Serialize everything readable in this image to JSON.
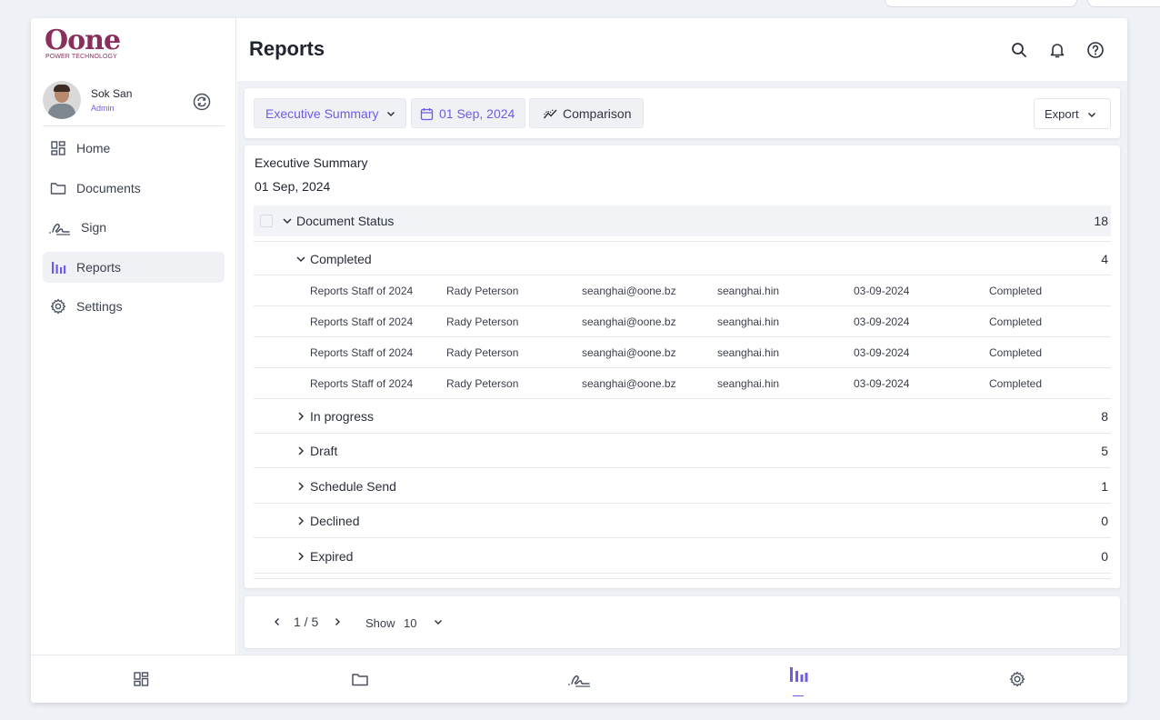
{
  "app": {
    "logo_text": "Oone",
    "logo_subtitle": "POWER TECHNOLOGY",
    "page_title": "Reports"
  },
  "user": {
    "name": "Sok San",
    "role": "Admin"
  },
  "sidebar": {
    "items": [
      {
        "label": "Home",
        "icon": "grid-icon",
        "active": false
      },
      {
        "label": "Documents",
        "icon": "folder-icon",
        "active": false
      },
      {
        "label": "Sign",
        "icon": "signature-icon",
        "active": false
      },
      {
        "label": "Reports",
        "icon": "bar-chart-icon",
        "active": true
      },
      {
        "label": "Settings",
        "icon": "gear-icon",
        "active": false
      }
    ]
  },
  "toolbar": {
    "report_type": "Executive Summary",
    "date": "01 Sep, 2024",
    "comparison_label": "Comparison",
    "export_label": "Export"
  },
  "report": {
    "title": "Executive Summary",
    "date": "01 Sep, 2024",
    "group": {
      "label": "Document Status",
      "count": "18"
    },
    "completed": {
      "label": "Completed",
      "count": "4",
      "rows": [
        {
          "document": "Reports Staff of 2024",
          "name": "Rady Peterson",
          "email": "seanghai@oone.bz",
          "username": "seanghai.hin",
          "date": "03-09-2024",
          "status": "Completed"
        },
        {
          "document": "Reports Staff of 2024",
          "name": "Rady Peterson",
          "email": "seanghai@oone.bz",
          "username": "seanghai.hin",
          "date": "03-09-2024",
          "status": "Completed"
        },
        {
          "document": "Reports Staff of 2024",
          "name": "Rady Peterson",
          "email": "seanghai@oone.bz",
          "username": "seanghai.hin",
          "date": "03-09-2024",
          "status": "Completed"
        },
        {
          "document": "Reports Staff of 2024",
          "name": "Rady Peterson",
          "email": "seanghai@oone.bz",
          "username": "seanghai.hin",
          "date": "03-09-2024",
          "status": "Completed"
        }
      ]
    },
    "statuses": [
      {
        "label": "In progress",
        "count": "8"
      },
      {
        "label": "Draft",
        "count": "5"
      },
      {
        "label": "Schedule Send",
        "count": "1"
      },
      {
        "label": "Declined",
        "count": "0"
      },
      {
        "label": "Expired",
        "count": "0"
      }
    ]
  },
  "pagination": {
    "page": "1 / 5",
    "show_label": "Show",
    "page_size": "10"
  },
  "colors": {
    "accent": "#6d5ce7",
    "brand": "#8a2f5c",
    "background": "#eef1f6"
  }
}
